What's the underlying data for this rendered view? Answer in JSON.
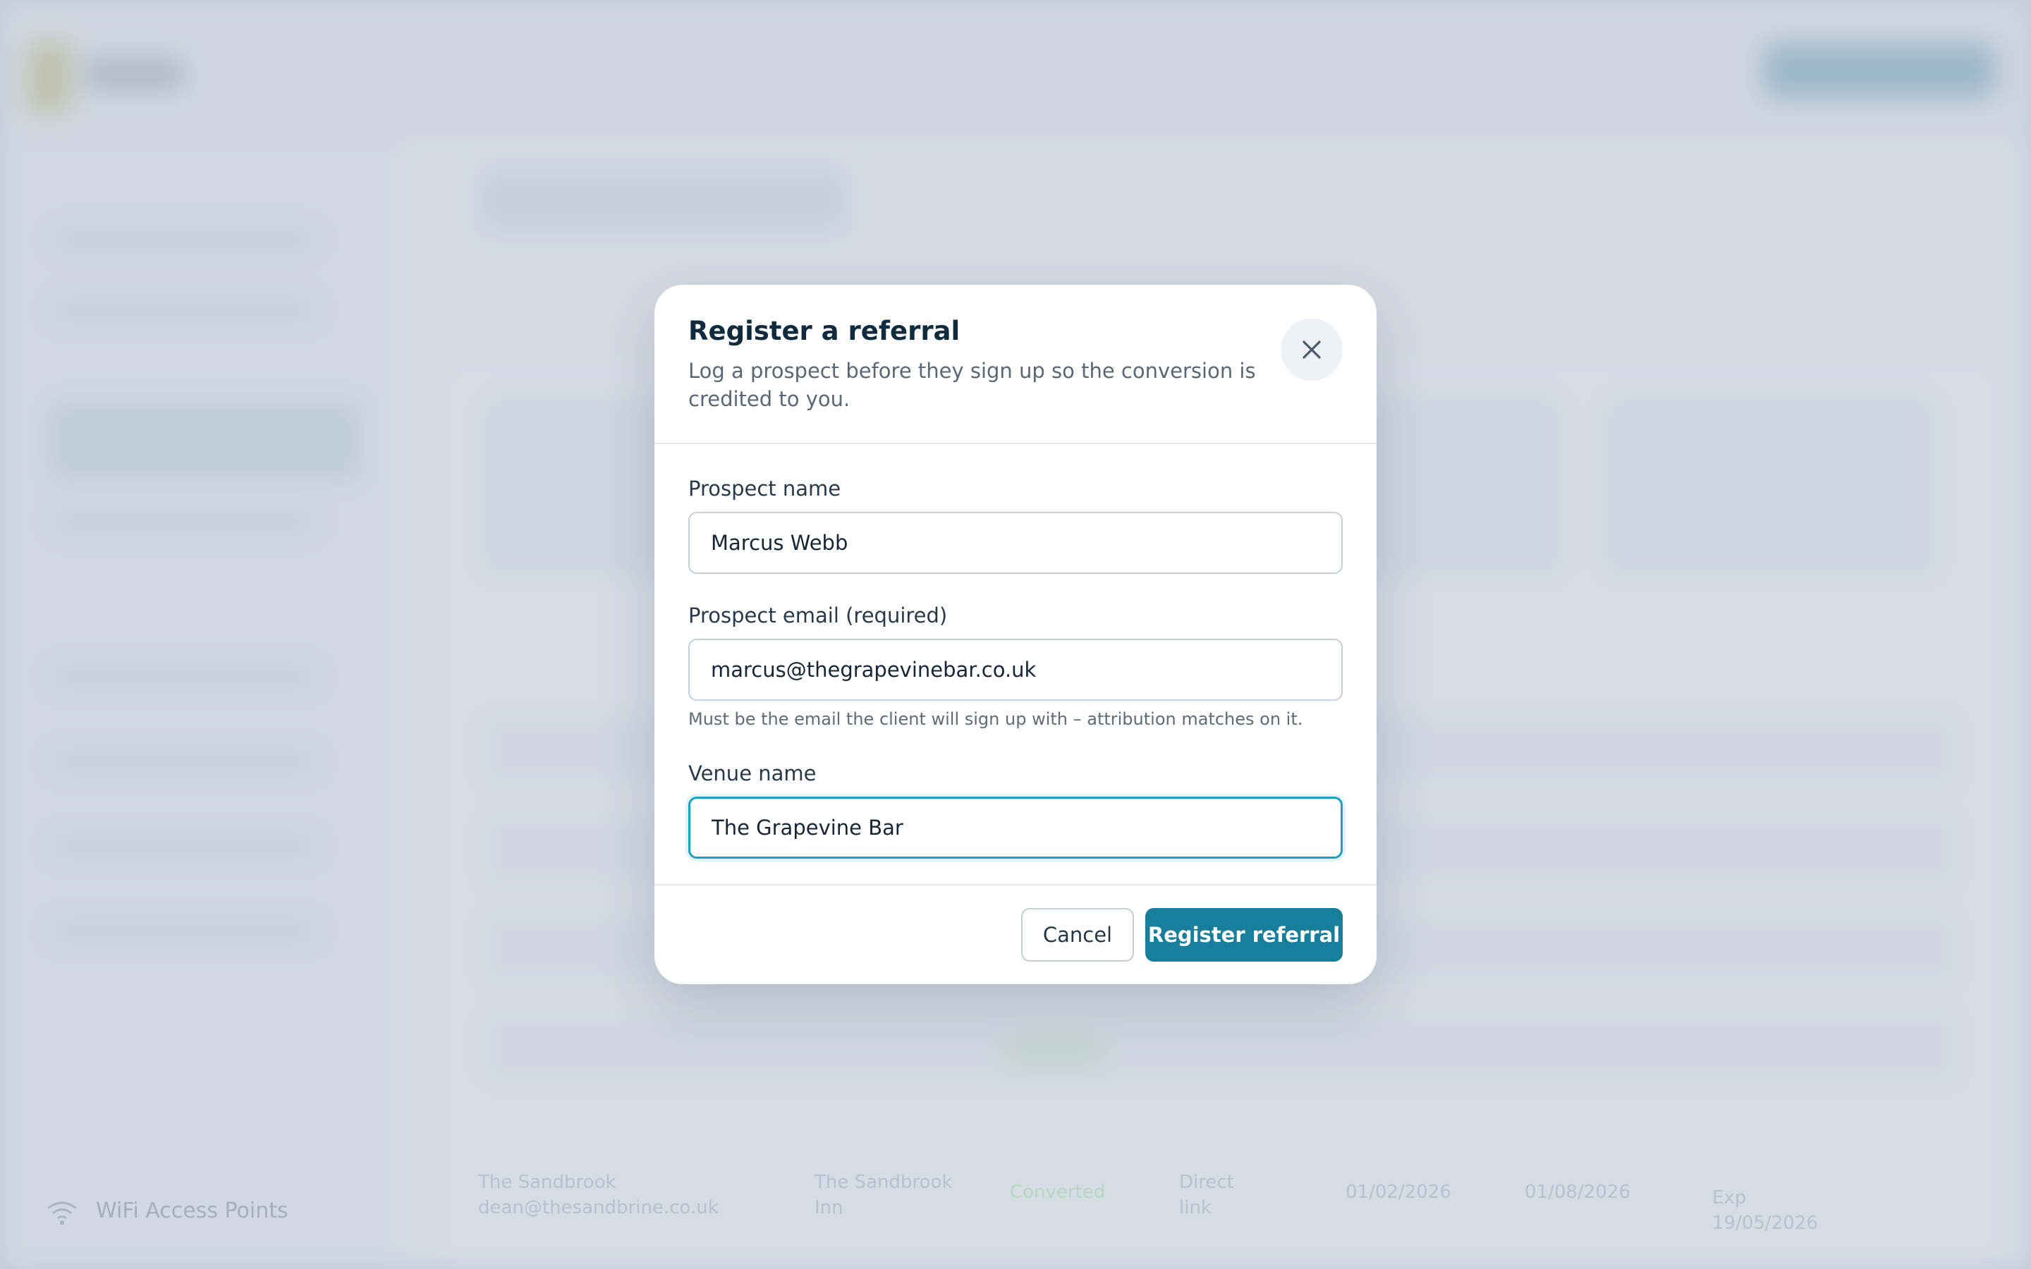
{
  "background": {
    "sidebar_item_label": "WiFi Access Points",
    "table_row": {
      "name_line1": "The Sandbrook",
      "name_line2": "dean@thesandbrine.co.uk",
      "type_line1": "The Sandbrook",
      "type_line2": "Inn",
      "status": "Converted",
      "source_line1": "Direct",
      "source_line2": "link",
      "date1": "01/02/2026",
      "date2": "01/08/2026",
      "expiry_line1": "Exp",
      "expiry_line2": "19/05/2026"
    }
  },
  "modal": {
    "title": "Register a referral",
    "subtitle": "Log a prospect before they sign up so the conversion is credited to you.",
    "close_icon": "close-icon",
    "fields": {
      "prospect_name": {
        "label": "Prospect name",
        "value": "Marcus Webb"
      },
      "prospect_email": {
        "label": "Prospect email (required)",
        "value": "marcus@thegrapevinebar.co.uk",
        "hint": "Must be the email the client will sign up with – attribution matches on it."
      },
      "venue_name": {
        "label": "Venue name",
        "value": "The Grapevine Bar"
      }
    },
    "buttons": {
      "cancel": "Cancel",
      "submit": "Register referral"
    }
  },
  "colors": {
    "primary": "#177e9b",
    "focus_ring": "#1aa0c4",
    "title": "#0f2b3d"
  }
}
